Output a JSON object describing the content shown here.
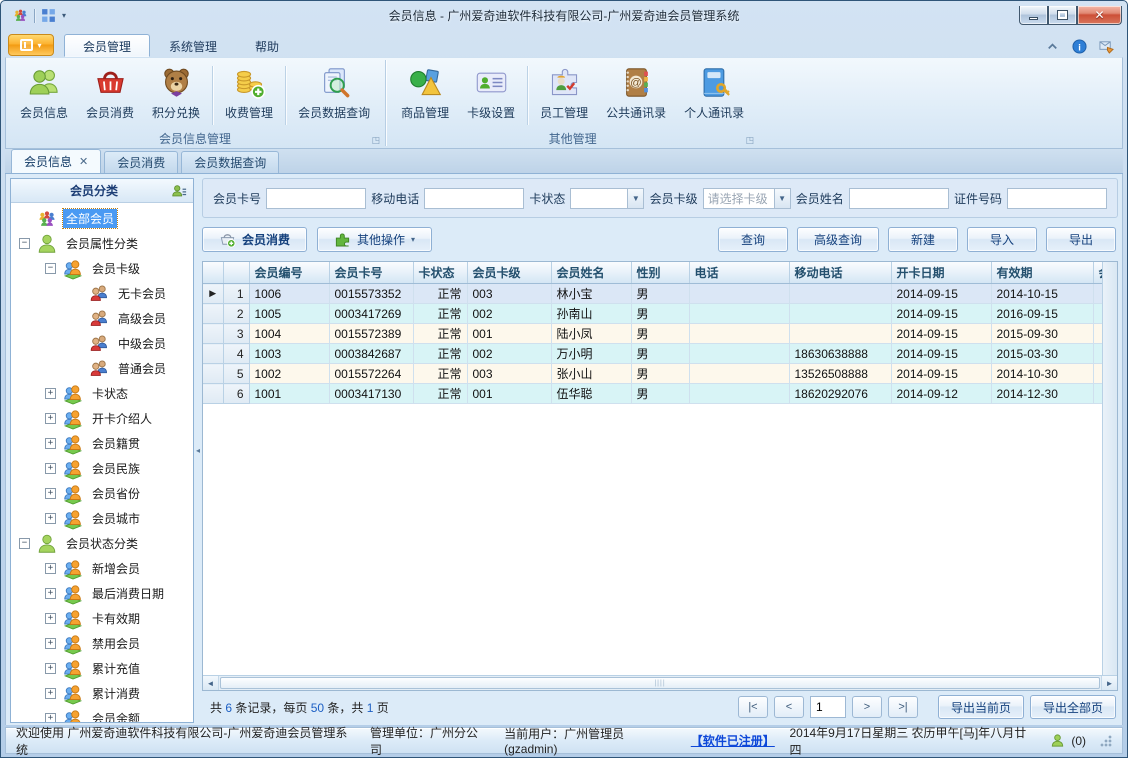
{
  "window": {
    "title": "会员信息 - 广州爱奇迪软件科技有限公司-广州爱奇迪会员管理系统"
  },
  "titlebar": {
    "qat_icons": [
      "app-logo-icon",
      "layout-grid-icon"
    ]
  },
  "ribbon": {
    "tabs": [
      {
        "label": "会员管理",
        "active": true
      },
      {
        "label": "系统管理",
        "active": false
      },
      {
        "label": "帮助",
        "active": false
      }
    ],
    "right_icons": [
      "collapse-ribbon-icon",
      "info-icon",
      "send-feedback-icon"
    ],
    "groups": [
      {
        "label": "会员信息管理",
        "sep_after": [
          2,
          3
        ],
        "buttons": [
          {
            "label": "会员信息",
            "icon": "members"
          },
          {
            "label": "会员消费",
            "icon": "basket"
          },
          {
            "label": "积分兑换",
            "icon": "bear"
          },
          {
            "label": "收费管理",
            "icon": "coins"
          },
          {
            "label": "会员数据查询",
            "icon": "search-doc"
          }
        ]
      },
      {
        "label": "其他管理",
        "sep_after": [
          1
        ],
        "buttons": [
          {
            "label": "商品管理",
            "icon": "goods"
          },
          {
            "label": "卡级设置",
            "icon": "card"
          },
          {
            "label": "员工管理",
            "icon": "staff"
          },
          {
            "label": "公共通讯录",
            "icon": "address-book"
          },
          {
            "label": "个人通讯录",
            "icon": "personal-book"
          }
        ]
      }
    ]
  },
  "doc_tabs": [
    {
      "label": "会员信息",
      "active": true,
      "closable": true
    },
    {
      "label": "会员消费",
      "active": false,
      "closable": false
    },
    {
      "label": "会员数据查询",
      "active": false,
      "closable": false
    }
  ],
  "sidebar": {
    "title": "会员分类",
    "tree": [
      {
        "label": "全部会员",
        "level": 0,
        "icon": "crowd",
        "expander": "none",
        "selected": true
      },
      {
        "label": "会员属性分类",
        "level": 0,
        "icon": "person-green",
        "expander": "minus"
      },
      {
        "label": "会员卡级",
        "level": 1,
        "icon": "people-pair",
        "expander": "minus"
      },
      {
        "label": "无卡会员",
        "level": 2,
        "icon": "member-pair",
        "expander": "none"
      },
      {
        "label": "高级会员",
        "level": 2,
        "icon": "member-pair",
        "expander": "none"
      },
      {
        "label": "中级会员",
        "level": 2,
        "icon": "member-pair",
        "expander": "none"
      },
      {
        "label": "普通会员",
        "level": 2,
        "icon": "member-pair",
        "expander": "none"
      },
      {
        "label": "卡状态",
        "level": 1,
        "icon": "people-pair",
        "expander": "plus"
      },
      {
        "label": "开卡介绍人",
        "level": 1,
        "icon": "people-pair",
        "expander": "plus"
      },
      {
        "label": "会员籍贯",
        "level": 1,
        "icon": "people-pair",
        "expander": "plus"
      },
      {
        "label": "会员民族",
        "level": 1,
        "icon": "people-pair",
        "expander": "plus"
      },
      {
        "label": "会员省份",
        "level": 1,
        "icon": "people-pair",
        "expander": "plus"
      },
      {
        "label": "会员城市",
        "level": 1,
        "icon": "people-pair",
        "expander": "plus"
      },
      {
        "label": "会员状态分类",
        "level": 0,
        "icon": "person-green",
        "expander": "minus"
      },
      {
        "label": "新增会员",
        "level": 1,
        "icon": "people-pair",
        "expander": "plus"
      },
      {
        "label": "最后消费日期",
        "level": 1,
        "icon": "people-pair",
        "expander": "plus"
      },
      {
        "label": "卡有效期",
        "level": 1,
        "icon": "people-pair",
        "expander": "plus"
      },
      {
        "label": "禁用会员",
        "level": 1,
        "icon": "people-pair",
        "expander": "plus"
      },
      {
        "label": "累计充值",
        "level": 1,
        "icon": "people-pair",
        "expander": "plus"
      },
      {
        "label": "累计消费",
        "level": 1,
        "icon": "people-pair",
        "expander": "plus"
      },
      {
        "label": "会员余额",
        "level": 1,
        "icon": "people-pair",
        "expander": "plus"
      }
    ]
  },
  "search": {
    "fields": [
      {
        "label": "会员卡号",
        "name": "member-card-no",
        "control": "input",
        "value": ""
      },
      {
        "label": "移动电话",
        "name": "mobile-phone",
        "control": "input",
        "value": ""
      },
      {
        "label": "卡状态",
        "name": "card-status",
        "control": "select",
        "value": "",
        "placeholder": false
      },
      {
        "label": "会员卡级",
        "name": "card-level",
        "control": "select",
        "value": "请选择卡级",
        "placeholder": true
      },
      {
        "label": "会员姓名",
        "name": "member-name",
        "control": "input",
        "value": ""
      },
      {
        "label": "证件号码",
        "name": "id-number",
        "control": "input",
        "value": ""
      }
    ]
  },
  "actions": {
    "consume": "会员消费",
    "other": "其他操作",
    "query": "查询",
    "advanced_query": "高级查询",
    "create": "新建",
    "import": "导入",
    "export": "导出"
  },
  "table": {
    "columns": [
      "会员编号",
      "会员卡号",
      "卡状态",
      "会员卡级",
      "会员姓名",
      "性别",
      "电话",
      "移动电话",
      "开卡日期",
      "有效期",
      "会员"
    ],
    "right_align_columns": [
      2
    ],
    "current_row": 0,
    "rows": [
      [
        "1006",
        "0015573352",
        "正常",
        "003",
        "林小宝",
        "男",
        "",
        "",
        "2014-09-15",
        "2014-10-15",
        ""
      ],
      [
        "1005",
        "0003417269",
        "正常",
        "002",
        "孙南山",
        "男",
        "",
        "",
        "2014-09-15",
        "2016-09-15",
        ""
      ],
      [
        "1004",
        "0015572389",
        "正常",
        "001",
        "陆小凤",
        "男",
        "",
        "",
        "2014-09-15",
        "2015-09-30",
        ""
      ],
      [
        "1003",
        "0003842687",
        "正常",
        "002",
        "万小明",
        "男",
        "",
        "18630638888",
        "2014-09-15",
        "2015-03-30",
        ""
      ],
      [
        "1002",
        "0015572264",
        "正常",
        "003",
        "张小山",
        "男",
        "",
        "13526508888",
        "2014-09-15",
        "2014-10-30",
        ""
      ],
      [
        "1001",
        "0003417130",
        "正常",
        "001",
        "伍华聪",
        "男",
        "",
        "18620292076",
        "2014-09-12",
        "2014-12-30",
        ""
      ]
    ]
  },
  "pager": {
    "summary": [
      [
        "共 ",
        0
      ],
      [
        "6",
        1
      ],
      [
        " 条记录，每页 ",
        0
      ],
      [
        "50",
        1
      ],
      [
        " 条，共 ",
        0
      ],
      [
        "1",
        1
      ],
      [
        " 页",
        0
      ]
    ],
    "first": "|<",
    "prev": "<",
    "page": "1",
    "next": ">",
    "last": ">|",
    "export_current": "导出当前页",
    "export_all": "导出全部页"
  },
  "statusbar": {
    "welcome": "欢迎使用 广州爱奇迪软件科技有限公司-广州爱奇迪会员管理系统",
    "unit": "管理单位：广州分公司",
    "user": "当前用户：广州管理员(gzadmin)",
    "license": "【软件已注册】",
    "date": "2014年9月17日星期三 农历甲午[马]年八月廿四",
    "messages": "(0)"
  },
  "colors": {
    "accent_orange": "#f6a41c",
    "selection_blue": "#4a9af3",
    "row_cyan": "#d8f4f6",
    "row_cream": "#fdf8ec",
    "close_red": "#cc4f37"
  }
}
